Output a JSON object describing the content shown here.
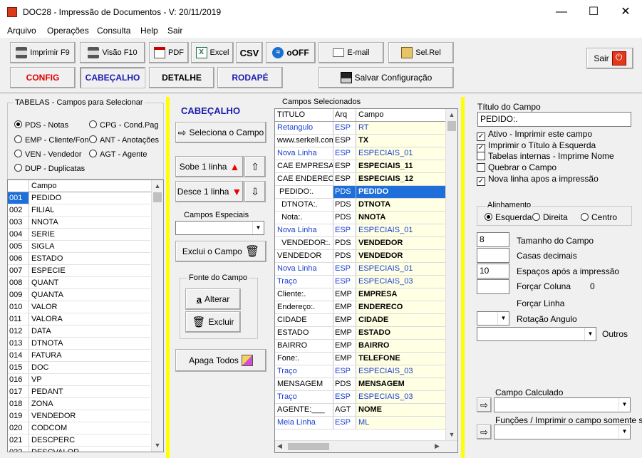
{
  "window": {
    "title": "DOC28 - Impressão de Documentos - V: 20/11/2019",
    "minimize": "—",
    "maximize": "☐",
    "close": "✕"
  },
  "menu": [
    "Arquivo",
    "Operações",
    "Consulta",
    "Help",
    "Sair"
  ],
  "toolbar": {
    "imprimir": "Imprimir F9",
    "visao": "Visão F10",
    "pdf": "PDF",
    "excel": "Excel",
    "csv": "CSV",
    "ooff": "oOFF",
    "email": "E-mail",
    "selrel": "Sel.Rel",
    "sair": "Sair",
    "config": "CONFIG",
    "cabecalho": "CABEÇALHO",
    "detalhe": "DETALHE",
    "rodape": "RODAPÉ",
    "salvar": "Salvar Configuração"
  },
  "tabelas": {
    "legend": "TABELAS - Campos para Selecionar",
    "options": [
      "PDS - Notas",
      "CPG - Cond.Pag",
      "EMP - Cliente/Fon",
      "ANT - Anotações",
      "VEN - Vendedor",
      "AGT - Agente",
      "DUP - Duplicatas"
    ],
    "col_header": "Campo",
    "rows": [
      [
        "001",
        "PEDIDO"
      ],
      [
        "002",
        "FILIAL"
      ],
      [
        "003",
        "NNOTA"
      ],
      [
        "004",
        "SERIE"
      ],
      [
        "005",
        "SIGLA"
      ],
      [
        "006",
        "ESTADO"
      ],
      [
        "007",
        "ESPECIE"
      ],
      [
        "008",
        "QUANT"
      ],
      [
        "009",
        "QUANTA"
      ],
      [
        "010",
        "VALOR"
      ],
      [
        "011",
        "VALORA"
      ],
      [
        "012",
        "DATA"
      ],
      [
        "013",
        "DTNOTA"
      ],
      [
        "014",
        "FATURA"
      ],
      [
        "015",
        "DOC"
      ],
      [
        "016",
        "VP"
      ],
      [
        "017",
        "PEDANT"
      ],
      [
        "018",
        "ZONA"
      ],
      [
        "019",
        "VENDEDOR"
      ],
      [
        "020",
        "CODCOM"
      ],
      [
        "021",
        "DESCPERC"
      ],
      [
        "022",
        "DESCVALOR"
      ]
    ]
  },
  "middle": {
    "heading": "CABEÇALHO",
    "seleciona": "Seleciona o Campo",
    "sobe": "Sobe 1 linha",
    "desce": "Desce 1 linha",
    "campos_especiais": "Campos Especiais",
    "exclui": "Exclui o Campo",
    "fonte_legend": "Fonte do Campo",
    "alterar": "Alterar",
    "excluir": "Excluir",
    "apaga": "Apaga Todos"
  },
  "selecionados": {
    "legend": "Campos Selecionados",
    "headers": [
      "TITULO",
      "Arq",
      "Campo"
    ],
    "rows": [
      {
        "t": "Retangulo",
        "a": "ESP",
        "c": "RT",
        "blue": true
      },
      {
        "t": "www.serkell.com",
        "a": "ESP",
        "c": "TX",
        "bold": true
      },
      {
        "t": "Nova Linha",
        "a": "ESP",
        "c": "ESPECIAIS_01",
        "blue": true
      },
      {
        "t": "CAE EMPRESA",
        "a": "ESP",
        "c": "ESPECIAIS_11",
        "bold": true
      },
      {
        "t": "CAE ENDERECO",
        "a": "ESP",
        "c": "ESPECIAIS_12",
        "bold": true
      },
      {
        "t": " PEDIDO:.",
        "a": "PDS",
        "c": "PEDIDO",
        "bold": true,
        "sel": true
      },
      {
        "t": "  DTNOTA:.",
        "a": "PDS",
        "c": "DTNOTA",
        "bold": true
      },
      {
        "t": "  Nota:.",
        "a": "PDS",
        "c": "NNOTA",
        "bold": true
      },
      {
        "t": "Nova Linha",
        "a": "ESP",
        "c": "ESPECIAIS_01",
        "blue": true
      },
      {
        "t": "  VENDEDOR:.",
        "a": "PDS",
        "c": "VENDEDOR",
        "bold": true
      },
      {
        "t": "VENDEDOR",
        "a": "PDS",
        "c": "VENDEDOR",
        "bold": true
      },
      {
        "t": "Nova Linha",
        "a": "ESP",
        "c": "ESPECIAIS_01",
        "blue": true
      },
      {
        "t": "Traço",
        "a": "ESP",
        "c": "ESPECIAIS_03",
        "blue": true
      },
      {
        "t": "Cliente:.",
        "a": "EMP",
        "c": "EMPRESA",
        "bold": true
      },
      {
        "t": "Endereço:.",
        "a": "EMP",
        "c": "ENDERECO",
        "bold": true
      },
      {
        "t": "CIDADE",
        "a": "EMP",
        "c": "CIDADE",
        "bold": true
      },
      {
        "t": "ESTADO",
        "a": "EMP",
        "c": "ESTADO",
        "bold": true
      },
      {
        "t": "BAIRRO",
        "a": "EMP",
        "c": "BAIRRO",
        "bold": true
      },
      {
        "t": "Fone:.",
        "a": "EMP",
        "c": "TELEFONE",
        "bold": true
      },
      {
        "t": "Traço",
        "a": "ESP",
        "c": "ESPECIAIS_03",
        "blue": true
      },
      {
        "t": "MENSAGEM",
        "a": "PDS",
        "c": "MENSAGEM",
        "bold": true
      },
      {
        "t": "Traço",
        "a": "ESP",
        "c": "ESPECIAIS_03",
        "blue": true
      },
      {
        "t": "AGENTE:___",
        "a": "AGT",
        "c": "NOME",
        "bold": true
      },
      {
        "t": "Meia Linha",
        "a": "ESP",
        "c": "ML",
        "blue": true
      }
    ]
  },
  "props": {
    "titulo_label": "Título do Campo",
    "titulo_value": "PEDIDO:.",
    "checks": [
      {
        "label": "Ativo - Imprimir este campo",
        "on": true
      },
      {
        "label": "Imprimir o Título à Esquerda",
        "on": true
      },
      {
        "label": "Tabelas internas - Imprime Nome",
        "on": false
      },
      {
        "label": "Quebrar o Campo",
        "on": false
      },
      {
        "label": "Nova linha apos a impressão",
        "on": true
      }
    ],
    "alinhamento": "Alinhamento",
    "align_opts": [
      "Esquerda",
      "Direita",
      "Centro"
    ],
    "tamanho_label": "Tamanho do Campo",
    "tamanho_value": "8",
    "casas_label": "Casas decimais",
    "casas_value": "",
    "espacos_label": "Espaços após a impressão",
    "espacos_value": "10",
    "forcar_coluna": "Forçar Coluna",
    "forcar_coluna_value": "0",
    "forcar_linha": "Forçar Linha",
    "rotacao": "Rotação Angulo",
    "outros": "Outros",
    "calculado": "Campo Calculado",
    "funcoes": "Funções / Imprimir o campo somente se"
  }
}
